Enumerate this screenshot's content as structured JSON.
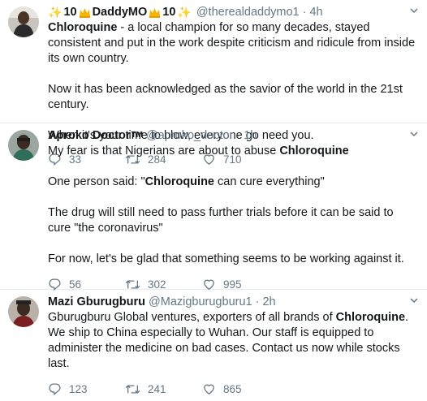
{
  "tweets": [
    {
      "name_num_left": "10",
      "name_main": "DaddyMO",
      "name_num_right": "10",
      "handle": "@therealdaddymo1",
      "dot": "·",
      "time": "4h",
      "para1_bold": "Chloroquine",
      "para1_rest": " - a local champion for so many decades, stayed consistent and put in the work despite criticism and ridicule from inside its own country.",
      "para2": "Now it has been acknowledged as the savior of the world in the 21st century.",
      "para3": "When it's your time to blow, everyone go need you.",
      "replies": "33",
      "retweets": "284",
      "likes": "710"
    },
    {
      "name": "Aproko Doctor",
      "name_mark": "TM",
      "handle": "@aproko_doctor",
      "dot": "·",
      "time": "1h",
      "p1_text": "My fear is that Nigerians are about to abuse ",
      "p1_bold": "Chloroquine",
      "p2_pre": "One person said: \"",
      "p2_bold": "Chloroquine",
      "p2_post": " can cure everything\"",
      "p3": "The drug will still need to pass further trials before it can be said to cure \"the coronavirus\"",
      "p4": "For now, let's be glad that something seems to be working against it.",
      "replies": "56",
      "retweets": "302",
      "likes": "995"
    },
    {
      "name": "Mazi Gburugburu",
      "handle": "@Mazigburugburu1",
      "dot": "·",
      "time": "2h",
      "p1_pre": "Gburugburu Global ventures, exporters of all brands of ",
      "p1_bold": "Chloroquine",
      "p1_post": ". We ship to China especially to Wuhan. Our staff is equipped to administer the medicine on bad cases. Contact us now while stocks last.",
      "replies": "123",
      "retweets": "241",
      "likes": "865"
    }
  ],
  "icons": {
    "reply": "reply-icon",
    "retweet": "retweet-icon",
    "like": "like-icon",
    "more": "chevron-down-icon",
    "star": "sparkles-emoji",
    "crown": "crown-emoji"
  },
  "colors": {
    "text": "#14171a",
    "secondary": "#657786",
    "divider": "#e6ecf0",
    "crown": "#f5b400"
  }
}
